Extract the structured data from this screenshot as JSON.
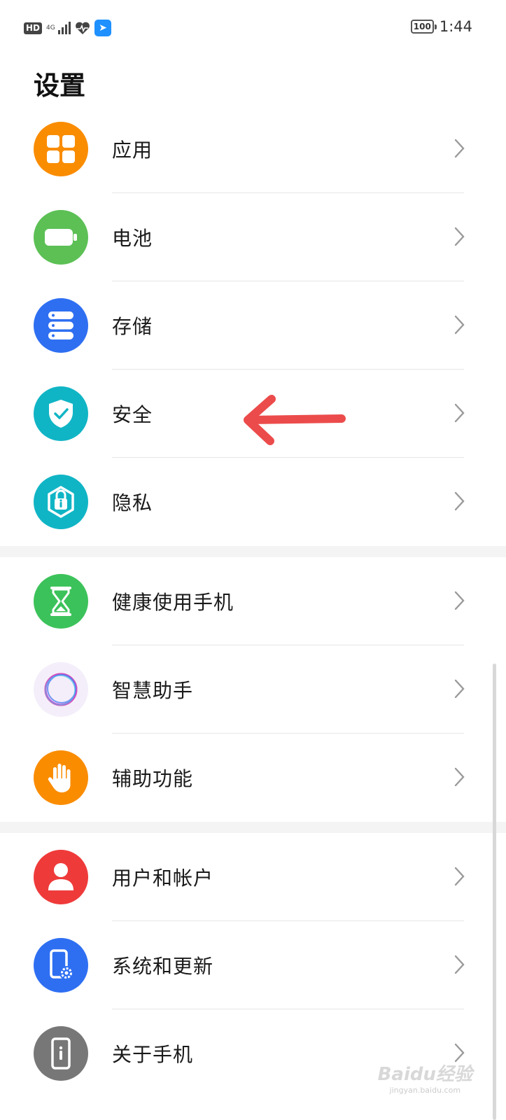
{
  "status_bar": {
    "hd": "HD",
    "network": "4G",
    "battery": "100",
    "time": "1:44"
  },
  "title": "设置",
  "groups": [
    [
      {
        "label": "应用",
        "icon": "apps-grid-icon",
        "color": "#fa8c00"
      },
      {
        "label": "电池",
        "icon": "battery-icon",
        "color": "#5cc055"
      },
      {
        "label": "存储",
        "icon": "storage-icon",
        "color": "#2e6ff2"
      },
      {
        "label": "安全",
        "icon": "shield-check-icon",
        "color": "#10b5c5"
      },
      {
        "label": "隐私",
        "icon": "privacy-lock-icon",
        "color": "#10b5c5"
      }
    ],
    [
      {
        "label": "健康使用手机",
        "icon": "hourglass-icon",
        "color": "#3cc25a"
      },
      {
        "label": "智慧助手",
        "icon": "smart-assistant-ring-icon",
        "color": "#f4eefa"
      },
      {
        "label": "辅助功能",
        "icon": "hand-icon",
        "color": "#fa8c00"
      }
    ],
    [
      {
        "label": "用户和帐户",
        "icon": "user-icon",
        "color": "#ef3a3a"
      },
      {
        "label": "系统和更新",
        "icon": "phone-gear-icon",
        "color": "#2e6ff2"
      },
      {
        "label": "关于手机",
        "icon": "phone-info-icon",
        "color": "#777777"
      }
    ]
  ],
  "annotation": {
    "icon": "red-arrow-icon",
    "color": "#ec4b4b"
  },
  "watermark": {
    "text": "Baidu经验",
    "sub": "jingyan.baidu.com"
  }
}
